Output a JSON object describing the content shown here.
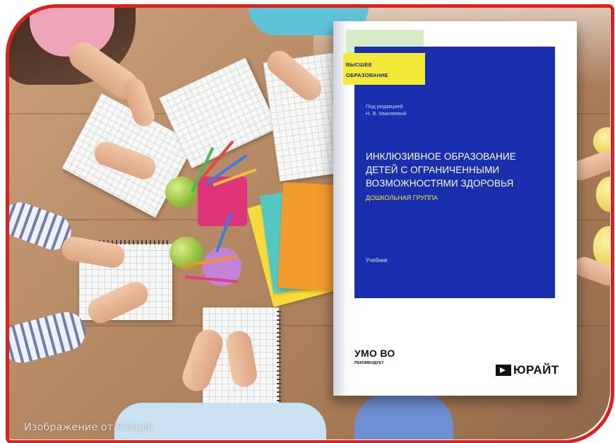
{
  "book": {
    "badge_line1": "ВЫСШЕЕ",
    "badge_line2": "ОБРАЗОВАНИЕ",
    "editor_label": "Под редакцией",
    "editor_name": "Н. В. Микляевой",
    "title_lines": [
      "ИНКЛЮЗИВНОЕ ОБРАЗОВАНИЕ",
      "ДЕТЕЙ С ОГРАНИЧЕННЫМИ",
      "ВОЗМОЖНОСТЯМИ ЗДОРОВЬЯ"
    ],
    "subtitle": "ДОШКОЛЬНАЯ ГРУППА",
    "type": "Учебник",
    "umo_main": "УМО ВО",
    "umo_sub": "РЕКОМЕНДУЕТ",
    "publisher": "ЮРАЙТ"
  },
  "caption": "Изображение от Freepik",
  "colors": {
    "frame_border": "#e0201c",
    "cover_blue": "#1a2fae",
    "badge_yellow": "#f2ea37",
    "strip_green": "#d7ebc6"
  }
}
